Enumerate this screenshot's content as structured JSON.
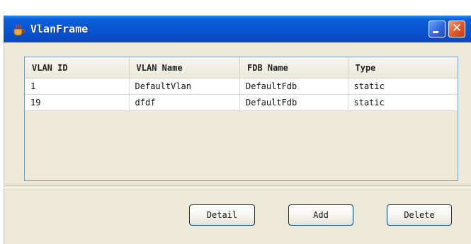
{
  "window": {
    "title": "VlanFrame",
    "icon": "java-cup-icon",
    "controls": {
      "minimize": "minimize",
      "close": "✕"
    }
  },
  "table": {
    "columns": [
      "VLAN ID",
      "VLAN Name",
      "FDB Name",
      "Type"
    ],
    "rows": [
      [
        "1",
        "DefaultVlan",
        "DefaultFdb",
        "static"
      ],
      [
        "19",
        "dfdf",
        "DefaultFdb",
        "static"
      ]
    ]
  },
  "buttons": {
    "detail": "Detail",
    "add": "Add",
    "delete": "Delete"
  },
  "colors": {
    "titlebar": "#0a55d1",
    "window_bg": "#ece9d8",
    "close_button": "#e2552b"
  }
}
